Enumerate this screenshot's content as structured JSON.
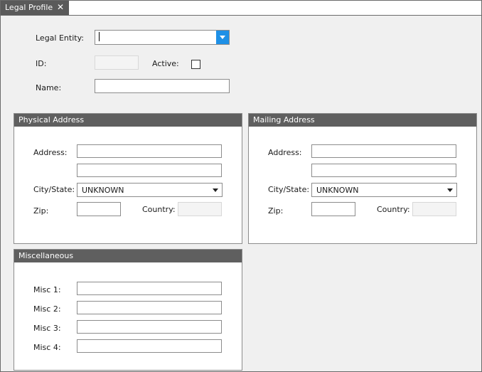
{
  "tab": {
    "title": "Legal Profile",
    "close_glyph": "✕"
  },
  "header": {
    "legal_entity_label": "Legal Entity:",
    "legal_entity_value": "",
    "id_label": "ID:",
    "id_value": "",
    "active_label": "Active:",
    "active_checked": false,
    "name_label": "Name:",
    "name_value": ""
  },
  "physical_address": {
    "title": "Physical Address",
    "address_label": "Address:",
    "address_line1": "",
    "address_line2": "",
    "city_state_label": "City/State:",
    "city_state_value": "UNKNOWN",
    "zip_label": "Zip:",
    "zip_value": "",
    "country_label": "Country:",
    "country_value": ""
  },
  "mailing_address": {
    "title": "Mailing Address",
    "address_label": "Address:",
    "address_line1": "",
    "address_line2": "",
    "city_state_label": "City/State:",
    "city_state_value": "UNKNOWN",
    "zip_label": "Zip:",
    "zip_value": "",
    "country_label": "Country:",
    "country_value": ""
  },
  "miscellaneous": {
    "title": "Miscellaneous",
    "fields": [
      {
        "label": "Misc 1:",
        "value": ""
      },
      {
        "label": "Misc 2:",
        "value": ""
      },
      {
        "label": "Misc 3:",
        "value": ""
      },
      {
        "label": "Misc 4:",
        "value": ""
      }
    ]
  },
  "colors": {
    "accent": "#1e90e6",
    "tab_bg": "#5a5a5a",
    "group_header": "#5f5f5f",
    "panel_bg": "#f0f0f0"
  },
  "icons": {
    "close": "close-icon",
    "dropdown": "chevron-down-icon"
  }
}
